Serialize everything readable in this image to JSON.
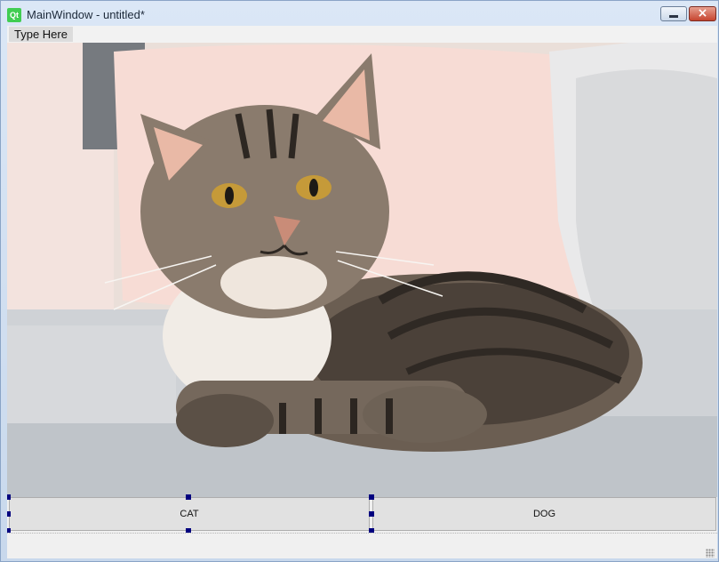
{
  "window": {
    "title": "MainWindow - untitled*",
    "app_icon": "Qt",
    "controls": {
      "minimize_icon": "minimize-icon",
      "close_icon": "close-icon",
      "close_glyph": "×"
    }
  },
  "menubar": {
    "items": [
      {
        "label": "Type Here"
      }
    ]
  },
  "image": {
    "subject": "cat-photo"
  },
  "buttons": {
    "cat_label": "CAT",
    "dog_label": "DOG"
  },
  "colors": {
    "qt_green": "#41cd52",
    "selection_handle": "#00007f",
    "button_face": "#e1e1e1",
    "close_red": "#c6452f"
  }
}
